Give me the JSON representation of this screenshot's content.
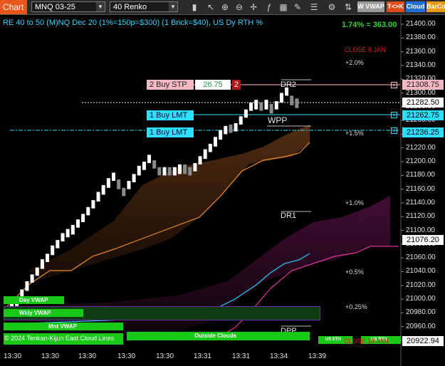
{
  "toolbar": {
    "chart_label": "Chart",
    "instrument": "MNQ 03-25",
    "period": "40 Renko",
    "btn_wvwap": "W VWAP",
    "btn_tk": "T<>K",
    "btn_cloud": "Cloud",
    "btn_barco": "BarCo",
    "colors": {
      "orange": "#e8571c",
      "wvwap_bg": "#9a9a9a",
      "tk_bg": "#e04a1a",
      "cloud_bg": "#1e6fd6",
      "barco_bg": "#e89a10"
    }
  },
  "header": {
    "title": "RE 40 to 50 (M)NQ Dec 20 (1%=150p=$300) (1 Brick=$40), US Dy RTH %",
    "pnl": "1.74% = 363.00",
    "close_note": "CLOSE 8 JAN"
  },
  "orders": {
    "buy_stop_label": "2 Buy STP",
    "buy_stop_offset": "26.75",
    "buy_stop_qty": "2",
    "buy_lmt_1": "1 Buy LMT",
    "buy_lmt_2": "1 Buy LMT"
  },
  "levels": {
    "dr2": "DR2",
    "wpp": "WPP",
    "dr1": "DR1",
    "dpp": "DPP"
  },
  "pct_labels": [
    "+2.0%",
    "+1.5%",
    "+1.0%",
    "+0.5%",
    "+0.25%"
  ],
  "price_tags": {
    "stop": "21308.75",
    "current": "21282.50",
    "lmt1": "21262.75",
    "lmt2": "21236.25",
    "cloud_mid": "21076.20",
    "low": "20922.94"
  },
  "bottom_bars": {
    "day_vwap": "Day VWAP",
    "wkly_vwap": "Wkly VWAP",
    "mnt_vwap": "Mnt VWAP",
    "copyright": "© 2024 Tenkan-Kijun East Cloud Lines",
    "outside_clouds": "Outside Clouds",
    "us_eth": "US ETH",
    "us_rth": "US RTH",
    "close_jan": "CLOSE 14 JAN"
  },
  "chart_data": {
    "type": "renko",
    "y_axis": {
      "min": 20920,
      "max": 21420,
      "ticks": [
        21400,
        21380,
        21360,
        21340,
        21320,
        21300,
        21280,
        21260,
        21240,
        21220,
        21200,
        21180,
        21160,
        21140,
        21120,
        21100,
        21080,
        21060,
        21040,
        21020,
        21000,
        20980,
        20960,
        20940
      ],
      "tick_labels": [
        "21400.00",
        "21380.00",
        "21360.00",
        "21340.00",
        "21320.00",
        "21300.00",
        "21280.00",
        "21260.00",
        "21240.00",
        "21220.00",
        "21200.00",
        "21180.00",
        "21160.00",
        "21140.00",
        "21120.00",
        "21100.00",
        "21080.00",
        "21060.00",
        "21040.00",
        "21020.00",
        "21000.00",
        "20980.00",
        "20960.00",
        "20940.00"
      ]
    },
    "x_labels": [
      "13:30",
      "13:30",
      "13:30",
      "13:30",
      "13:30",
      "13:31",
      "13:31",
      "13:34",
      "13:39"
    ],
    "bricks": [
      {
        "low": 20984,
        "high": 20996,
        "up": true
      },
      {
        "low": 20990,
        "high": 21004,
        "up": true
      },
      {
        "low": 21000,
        "high": 21014,
        "up": true
      },
      {
        "low": 21012,
        "high": 21026,
        "up": true
      },
      {
        "low": 21024,
        "high": 21036,
        "up": true
      },
      {
        "low": 21034,
        "high": 21046,
        "up": true
      },
      {
        "low": 21044,
        "high": 21058,
        "up": true
      },
      {
        "low": 21054,
        "high": 21066,
        "up": true
      },
      {
        "low": 21064,
        "high": 21078,
        "up": true
      },
      {
        "low": 21074,
        "high": 21086,
        "up": true
      },
      {
        "low": 21084,
        "high": 21096,
        "up": true
      },
      {
        "low": 21090,
        "high": 21102,
        "up": true
      },
      {
        "low": 21094,
        "high": 21108,
        "up": true
      },
      {
        "low": 21104,
        "high": 21116,
        "up": true
      },
      {
        "low": 21112,
        "high": 21124,
        "up": true
      },
      {
        "low": 21122,
        "high": 21134,
        "up": true
      },
      {
        "low": 21132,
        "high": 21144,
        "up": true
      },
      {
        "low": 21142,
        "high": 21156,
        "up": true
      },
      {
        "low": 21152,
        "high": 21166,
        "up": true
      },
      {
        "low": 21162,
        "high": 21176,
        "up": true
      },
      {
        "low": 21172,
        "high": 21184,
        "up": true
      },
      {
        "low": 21160,
        "high": 21174,
        "up": false
      },
      {
        "low": 21150,
        "high": 21162,
        "up": false
      },
      {
        "low": 21160,
        "high": 21172,
        "up": true
      },
      {
        "low": 21170,
        "high": 21182,
        "up": true
      },
      {
        "low": 21180,
        "high": 21194,
        "up": true
      },
      {
        "low": 21188,
        "high": 21200,
        "up": true
      },
      {
        "low": 21198,
        "high": 21210,
        "up": true
      },
      {
        "low": 21190,
        "high": 21202,
        "up": false
      },
      {
        "low": 21180,
        "high": 21192,
        "up": false
      },
      {
        "low": 21180,
        "high": 21192,
        "up": true
      },
      {
        "low": 21180,
        "high": 21192,
        "up": false
      },
      {
        "low": 21180,
        "high": 21192,
        "up": true
      },
      {
        "low": 21182,
        "high": 21196,
        "up": true
      },
      {
        "low": 21182,
        "high": 21196,
        "up": false
      },
      {
        "low": 21180,
        "high": 21192,
        "up": false
      },
      {
        "low": 21186,
        "high": 21198,
        "up": true
      },
      {
        "low": 21196,
        "high": 21208,
        "up": true
      },
      {
        "low": 21204,
        "high": 21218,
        "up": true
      },
      {
        "low": 21214,
        "high": 21226,
        "up": true
      },
      {
        "low": 21222,
        "high": 21236,
        "up": true
      },
      {
        "low": 21232,
        "high": 21246,
        "up": true
      },
      {
        "low": 21240,
        "high": 21252,
        "up": true
      },
      {
        "low": 21242,
        "high": 21254,
        "up": false
      },
      {
        "low": 21244,
        "high": 21256,
        "up": true
      },
      {
        "low": 21254,
        "high": 21266,
        "up": true
      },
      {
        "low": 21264,
        "high": 21276,
        "up": true
      },
      {
        "low": 21274,
        "high": 21286,
        "up": true
      },
      {
        "low": 21276,
        "high": 21290,
        "up": true
      },
      {
        "low": 21274,
        "high": 21286,
        "up": false
      },
      {
        "low": 21276,
        "high": 21290,
        "up": true
      },
      {
        "low": 21270,
        "high": 21284,
        "up": false
      },
      {
        "low": 21276,
        "high": 21288,
        "up": true
      },
      {
        "low": 21286,
        "high": 21300,
        "up": true
      },
      {
        "low": 21296,
        "high": 21308,
        "up": true
      },
      {
        "low": 21282,
        "high": 21296,
        "up": false
      },
      {
        "low": 21278,
        "high": 21292,
        "up": false
      }
    ]
  }
}
